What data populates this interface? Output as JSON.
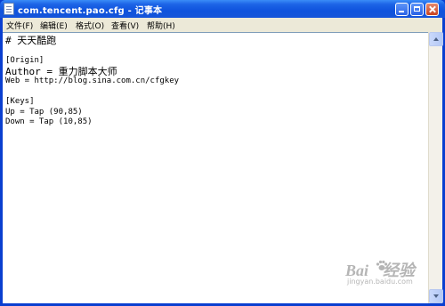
{
  "window": {
    "title": "com.tencent.pao.cfg - 记事本"
  },
  "menu": {
    "items": [
      {
        "label": "文件(F)"
      },
      {
        "label": "编辑(E)"
      },
      {
        "label": "格式(O)"
      },
      {
        "label": "查看(V)"
      },
      {
        "label": "帮助(H)"
      }
    ]
  },
  "document": {
    "lines": [
      "# 天天酷跑",
      "",
      "[Origin]",
      "Author = 重力脚本大师",
      "Web = http://blog.sina.com.cn/cfgkey",
      "",
      "[Keys]",
      "Up = Tap (90,85)",
      "Down = Tap (10,85)"
    ]
  },
  "watermark": {
    "logo_left": "Bai",
    "logo_right": "经验",
    "url": "jingyan.baidu.com"
  },
  "colors": {
    "titlebar": "#0f53dd",
    "menubar": "#ece9d8",
    "editor_bg": "#ffffff",
    "close_button": "#c9431f"
  }
}
